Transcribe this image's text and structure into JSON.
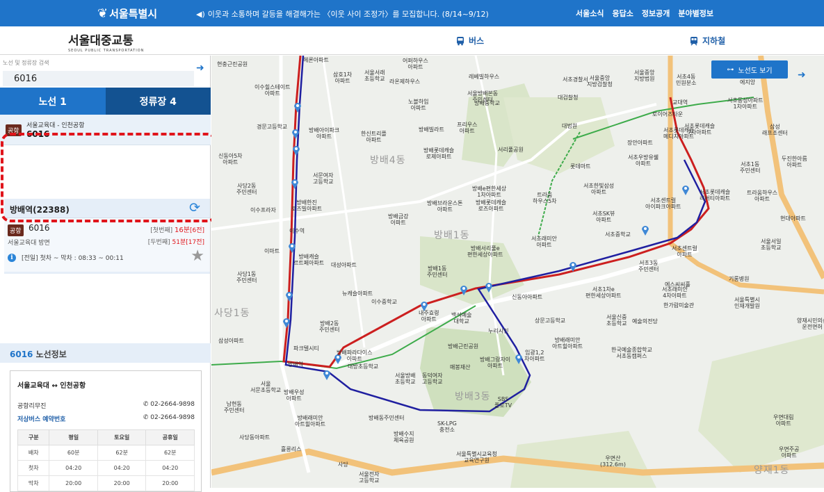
{
  "topbar": {
    "logo_text": "서울특별시",
    "notice_icon": "speaker-icon",
    "notice": "이웃과 소통하며 갈등을 해결해가는 〈이웃 사이 조정가〉를 모집합니다. (8/14~9/12)",
    "nav": [
      "서울소식",
      "응답소",
      "정보공개",
      "분야별정보"
    ],
    "bg_color": "#1f74c9"
  },
  "header": {
    "brand_ko": "서울대중교통",
    "brand_en": "SEOUL PUBLIC TRANSPORTATION",
    "nav_bus": "버스",
    "nav_subway": "지하철"
  },
  "search": {
    "label": "노선 및 정류장 검색",
    "value": "6016"
  },
  "tabs": {
    "routes": "노선 1",
    "stops": "정류장 4"
  },
  "result": {
    "badge": "공항",
    "route_name": "서울교육대 - 인천공항",
    "number": "6016"
  },
  "stop": {
    "title": "방배역(22388)",
    "badge": "공항",
    "bus_number": "6016",
    "direction": "서울교육대 방면",
    "first_label": "[첫번째]",
    "first_time": "16분",
    "first_stops": "[6전]",
    "second_label": "[두번째]",
    "second_time": "51분",
    "second_stops": "[17전]",
    "hours": "[전일] 첫차 ~ 막차 : 08:33 ~ 00:11"
  },
  "route_info": {
    "number": "6016",
    "title_suffix": " 노선정보",
    "from": "서울교육대",
    "to": "인천공항",
    "company": "공항리무진",
    "company_phone": "02-2664-9898",
    "reserve_label": "저상버스 예약번호",
    "reserve_phone": "02-2664-9898",
    "table": {
      "headers": [
        "구분",
        "평일",
        "토요일",
        "공휴일"
      ],
      "rows": [
        [
          "배차",
          "60분",
          "62분",
          "62분"
        ],
        [
          "첫차",
          "04:20",
          "04:20",
          "04:20"
        ],
        [
          "막차",
          "20:00",
          "20:00",
          "20:00"
        ]
      ]
    }
  },
  "map": {
    "lineview_button": "노선도 보기",
    "labels": [
      "헤론아파트",
      "현충근린공원",
      "이수힐스테이트",
      "아파트",
      "삼호1차",
      "아파트",
      "서울서래",
      "초등학교",
      "어퍼하우스",
      "아파트",
      "서초경찰서",
      "서울중앙",
      "지방검찰청",
      "서울중앙",
      "지방법원",
      "서초4동",
      "민원분소",
      "에지앙",
      "라온제하우스",
      "레베빌하우스",
      "서울방배본동",
      "주민센터",
      "노블하임",
      "아파트",
      "방배중학교",
      "대검찰청",
      "교대역",
      "서초동성아파트",
      "1차아파트",
      "경문고등학교",
      "방배아이파크",
      "아파트",
      "한신트리플",
      "아파트",
      "방배빌라트",
      "프리우스",
      "아파트",
      "대법원",
      "로이어즈타운",
      "서초롯데캐슬",
      "7차아파트",
      "삼성",
      "래프조센터",
      "서초롯데캐슬",
      "메디치아파트",
      "신동아5차",
      "아파트",
      "서리풀공원",
      "방배롯데캐슬",
      "로제아파트",
      "장안아파트",
      "사당2동",
      "주민센터",
      "서문여자",
      "고등학교",
      "롯데마트",
      "서초우방유쉘",
      "아파트",
      "서초1동",
      "주민센터",
      "두진한아름",
      "아파트",
      "방배e편한세상",
      "1차아파트",
      "서초한빛삼성",
      "아파트",
      "서초롯데캐슬",
      "리버티아파트",
      "트라움하우스",
      "아파트",
      "이수프라자",
      "방배한진",
      "로즈빌아파트",
      "방배롯데캐슬",
      "로즈아파트",
      "방배브라운스톤",
      "아파트",
      "트라움",
      "하우스5차",
      "방배금강",
      "아파트",
      "서초SK뷰",
      "아파트",
      "서초센트럴",
      "아이파크아파트",
      "현대아파트",
      "이수역",
      "방배4동",
      "이마트",
      "방배서리풀e",
      "편한세상아파트",
      "서초래미안",
      "아파트",
      "서초중학교",
      "서초3동",
      "주민센터",
      "서초센트럴",
      "아파트",
      "사당1동",
      "주민센터",
      "방배캐슬",
      "르트페아파트",
      "대성아파트",
      "방배1동",
      "주민센터",
      "서울서일",
      "초등학교",
      "서초1차e",
      "편한세상아파트",
      "서초래미안",
      "4차아파트",
      "기롱병원",
      "에스씨씨홀",
      "뉴캐슬아파트",
      "이수중학교",
      "신동아아파트",
      "서울특별시",
      "인재개발원",
      "방배2동",
      "주민센터",
      "내주효령",
      "아파트",
      "백석예술",
      "대학교",
      "상문고등학교",
      "서울신중",
      "초등학교",
      "예술의전당",
      "한가람미술관",
      "양재시민의숲",
      "운전면허",
      "누리시인",
      "삼성아파트",
      "방배근린공원",
      "방배래미안",
      "아트힐아파트",
      "한국예술종합학교",
      "서초동캠퍼스",
      "파크텔시티",
      "방배파라다이스",
      "아파트",
      "임광1,2",
      "차아파트",
      "방배역",
      "서울방배",
      "초등학교",
      "동덕여자",
      "고등학교",
      "매봉재산",
      "방배그랑자이",
      "아파트",
      "서울",
      "서문초등학교",
      "방배우성",
      "아파트",
      "대방초등학교",
      "SBS",
      "플로TV",
      "남현동",
      "주민센터",
      "방배래미안",
      "아트힐아파트",
      "SK-LPG",
      "충전소",
      "방배동주민센터",
      "방배수지",
      "체육공원",
      "서울특별시교육청",
      "교육연구원",
      "사당동아파트",
      "흘릉리스",
      "사당",
      "서울전자",
      "고등학교",
      "우면산",
      "(312.6m)",
      "우면대림",
      "아파트",
      "우면주공",
      "아파트"
    ],
    "district_labels": [
      "방배4동",
      "방배1동",
      "사당1동",
      "방배3동",
      "양재1동"
    ],
    "colors": {
      "route_red": "#cc1f1f",
      "route_blue": "#1f1fa0",
      "park": "#d9e5c9",
      "road_main": "#f2c27a"
    }
  }
}
